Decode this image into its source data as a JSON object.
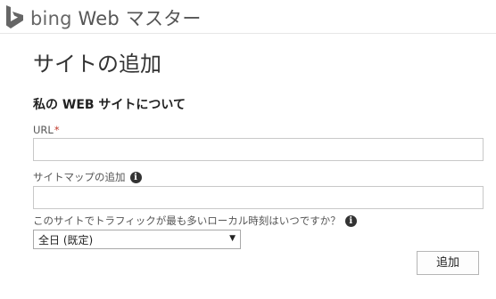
{
  "header": {
    "brand_bing": "bing",
    "brand_suffix": "Web マスター",
    "logo_icon": "bing-logo-icon",
    "logo_color": "#666666"
  },
  "page": {
    "title": "サイトの追加"
  },
  "form": {
    "section_title": "私の WEB サイトについて",
    "url_label": "URL",
    "required_mark": "*",
    "url_value": "",
    "sitemap_label": "サイトマップの追加",
    "sitemap_value": "",
    "traffic_label": "このサイトでトラフィックが最も多いローカル時刻はいつですか？",
    "traffic_selected": "全日 (既定)",
    "info_icon": "info-icon",
    "submit_label": "追加"
  }
}
